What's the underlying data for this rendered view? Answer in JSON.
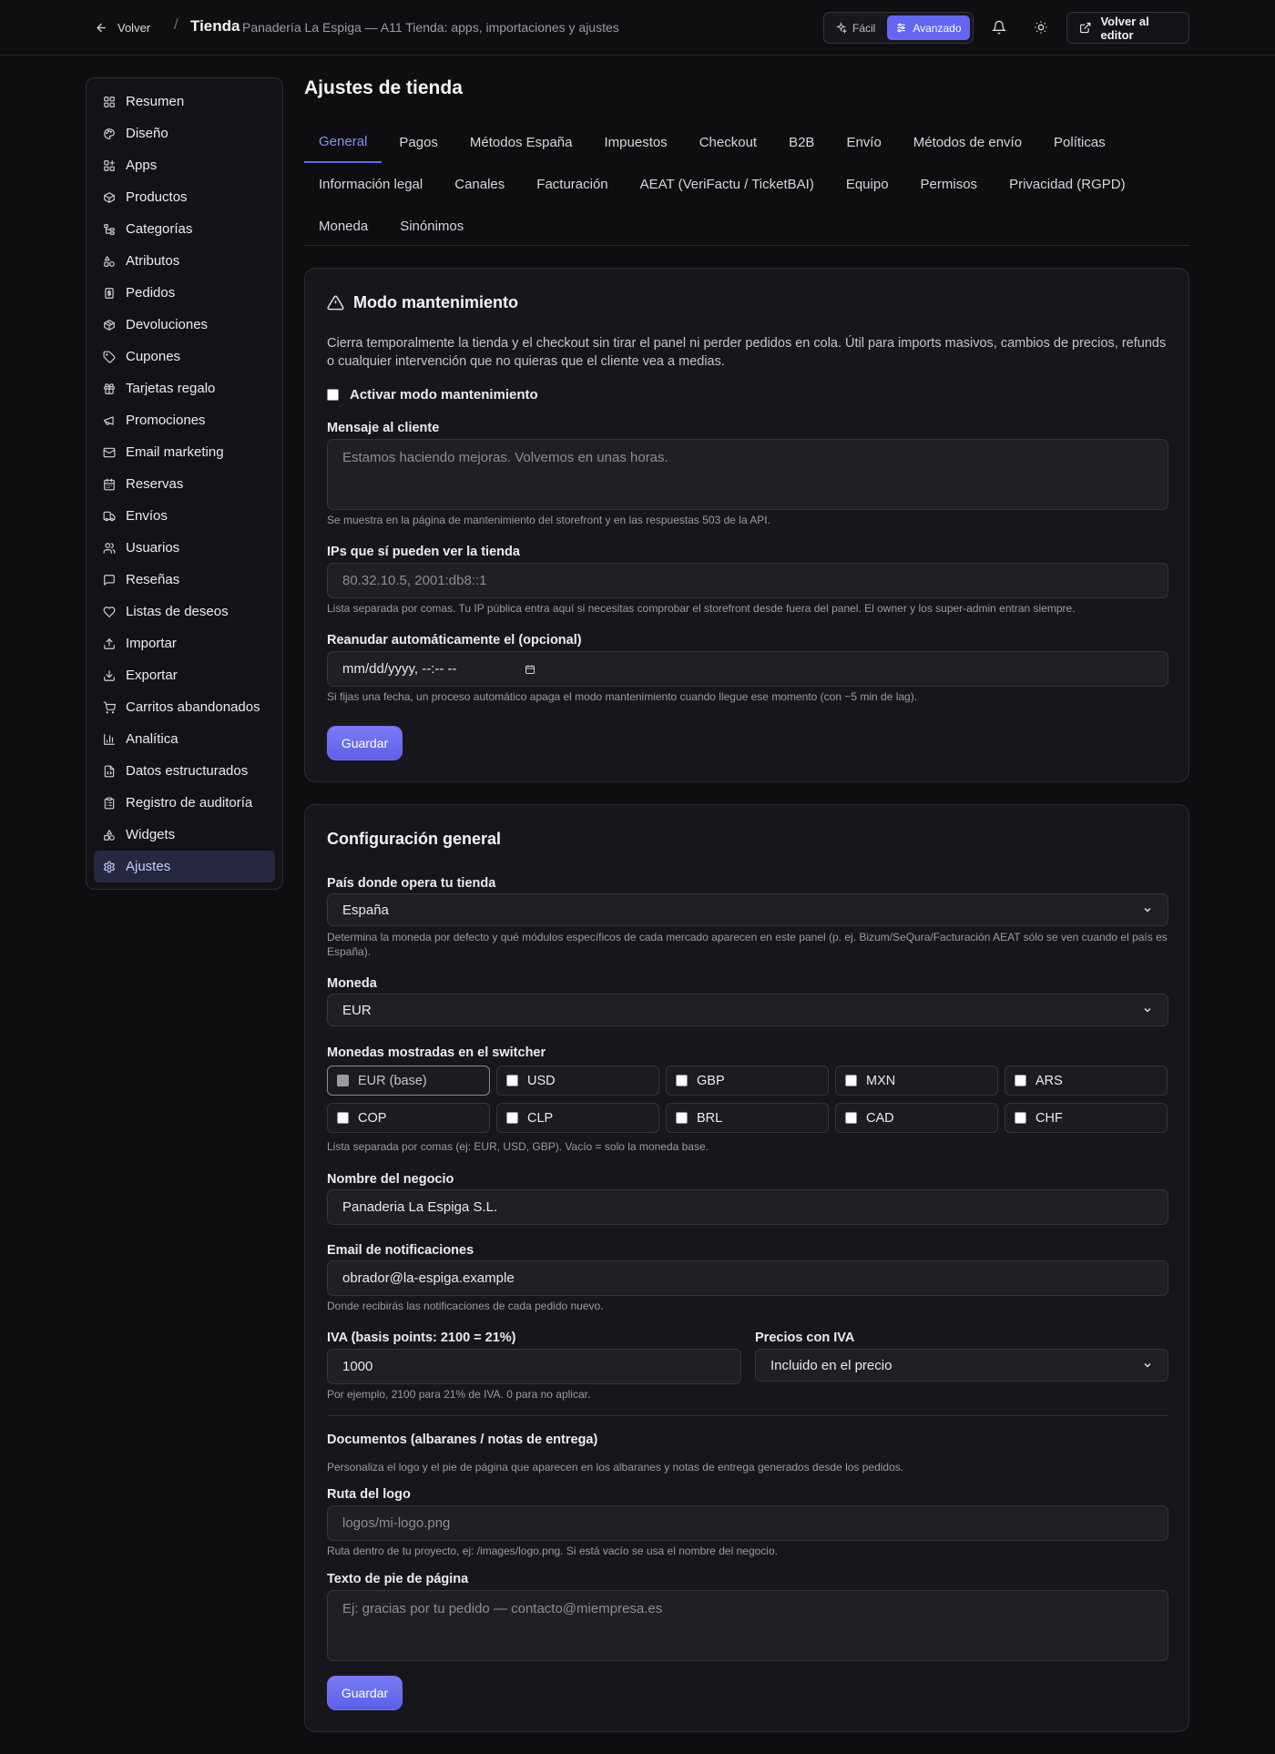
{
  "header": {
    "back_label": "Volver",
    "separator": "/",
    "title": "Tienda",
    "subtitle": "Panadería La Espiga — A11 Tienda: apps, importaciones y ajustes",
    "modes": [
      "Fácil",
      "Avanzado"
    ],
    "active_mode": "Avanzado",
    "editor_label": "Volver al editor"
  },
  "sidebar": {
    "items": [
      {
        "label": "Resumen",
        "icon": "grid-icon"
      },
      {
        "label": "Diseño",
        "icon": "palette-icon"
      },
      {
        "label": "Apps",
        "icon": "apps-icon"
      },
      {
        "label": "Productos",
        "icon": "box-icon"
      },
      {
        "label": "Categorías",
        "icon": "tree-icon"
      },
      {
        "label": "Atributos",
        "icon": "shapes-icon"
      },
      {
        "label": "Pedidos",
        "icon": "receipt-icon"
      },
      {
        "label": "Devoluciones",
        "icon": "box-return-icon"
      },
      {
        "label": "Cupones",
        "icon": "tag-icon"
      },
      {
        "label": "Tarjetas regalo",
        "icon": "gift-icon"
      },
      {
        "label": "Promociones",
        "icon": "megaphone-icon"
      },
      {
        "label": "Email marketing",
        "icon": "mail-icon"
      },
      {
        "label": "Reservas",
        "icon": "calendar-icon"
      },
      {
        "label": "Envíos",
        "icon": "truck-icon"
      },
      {
        "label": "Usuarios",
        "icon": "users-icon"
      },
      {
        "label": "Reseñas",
        "icon": "message-icon"
      },
      {
        "label": "Listas de deseos",
        "icon": "heart-icon"
      },
      {
        "label": "Importar",
        "icon": "upload-icon"
      },
      {
        "label": "Exportar",
        "icon": "download-icon"
      },
      {
        "label": "Carritos abandonados",
        "icon": "cart-icon"
      },
      {
        "label": "Analítica",
        "icon": "chart-icon"
      },
      {
        "label": "Datos estructurados",
        "icon": "file-code-icon"
      },
      {
        "label": "Registro de auditoría",
        "icon": "clipboard-icon"
      },
      {
        "label": "Widgets",
        "icon": "widgets-icon"
      },
      {
        "label": "Ajustes",
        "icon": "gear-icon"
      }
    ],
    "active": "Ajustes"
  },
  "main": {
    "title": "Ajustes de tienda",
    "tab_rows": [
      [
        "General",
        "Pagos",
        "Métodos España",
        "Impuestos",
        "Checkout",
        "B2B",
        "Envío",
        "Métodos de envío",
        "Políticas"
      ],
      [
        "Información legal",
        "Canales",
        "Facturación",
        "AEAT (VeriFactu / TicketBAI)",
        "Equipo",
        "Permisos",
        "Privacidad (RGPD)"
      ],
      [
        "Moneda",
        "Sinónimos"
      ]
    ],
    "active_tab": "General"
  },
  "maintenance": {
    "title": "Modo mantenimiento",
    "description": "Cierra temporalmente la tienda y el checkout sin tirar el panel ni perder pedidos en cola. Útil para imports masivos, cambios de precios, refunds o cualquier intervención que no quieras que el cliente vea a medias.",
    "toggle_label": "Activar modo mantenimiento",
    "toggle_checked": false,
    "message_label": "Mensaje al cliente",
    "message_placeholder": "Estamos haciendo mejoras. Volvemos en unas horas.",
    "message_hint": "Se muestra en la página de mantenimiento del storefront y en las respuestas 503 de la API.",
    "ips_label": "IPs que sí pueden ver la tienda",
    "ips_placeholder": "80.32.10.5, 2001:db8::1",
    "ips_hint": "Lista separada por comas. Tu IP pública entra aquí si necesitas comprobar el storefront desde fuera del panel. El owner y los super-admin entran siempre.",
    "resume_label": "Reanudar automáticamente el (opcional)",
    "resume_placeholder": "mm/dd/yyyy, --:-- --",
    "resume_hint": "Si fijas una fecha, un proceso automático apaga el modo mantenimiento cuando llegue ese momento (con ~5 min de lag).",
    "save_label": "Guardar"
  },
  "general": {
    "title": "Configuración general",
    "country_label": "País donde opera tu tienda",
    "country_value": "España",
    "country_hint": "Determina la moneda por defecto y qué módulos específicos de cada mercado aparecen en este panel (p. ej. Bizum/SeQura/Facturación AEAT sólo se ven cuando el país es España).",
    "currency_label": "Moneda",
    "currency_value": "EUR",
    "switcher_label": "Monedas mostradas en el switcher",
    "switcher_options": [
      "EUR (base)",
      "USD",
      "GBP",
      "MXN",
      "ARS",
      "COP",
      "CLP",
      "BRL",
      "CAD",
      "CHF"
    ],
    "switcher_hint": "Lista separada por comas (ej: EUR, USD, GBP). Vacío = solo la moneda base.",
    "business_label": "Nombre del negocio",
    "business_value": "Panaderia La Espiga S.L.",
    "email_label": "Email de notificaciones",
    "email_value": "obrador@la-espiga.example",
    "email_hint": "Donde recibirás las notificaciones de cada pedido nuevo.",
    "vat_label": "IVA (basis points: 2100 = 21%)",
    "vat_value": "1000",
    "vat_hint": "Por ejemplo, 2100 para 21% de IVA. 0 para no aplicar.",
    "prices_label": "Precios con IVA",
    "prices_value": "Incluido en el precio",
    "docs_title": "Documentos (albaranes / notas de entrega)",
    "docs_desc": "Personaliza el logo y el pie de página que aparecen en los albaranes y notas de entrega generados desde los pedidos.",
    "logo_label": "Ruta del logo",
    "logo_placeholder": "logos/mi-logo.png",
    "logo_hint": "Ruta dentro de tu proyecto, ej: /images/logo.png. Si está vacío se usa el nombre del negocio.",
    "footer_label": "Texto de pie de página",
    "footer_placeholder": "Ej: gracias por tu pedido — contacto@miempresa.es",
    "save_label": "Guardar"
  },
  "colors": {
    "accent": "#6366f1",
    "background": "#0e0e11",
    "card": "#17171b"
  }
}
